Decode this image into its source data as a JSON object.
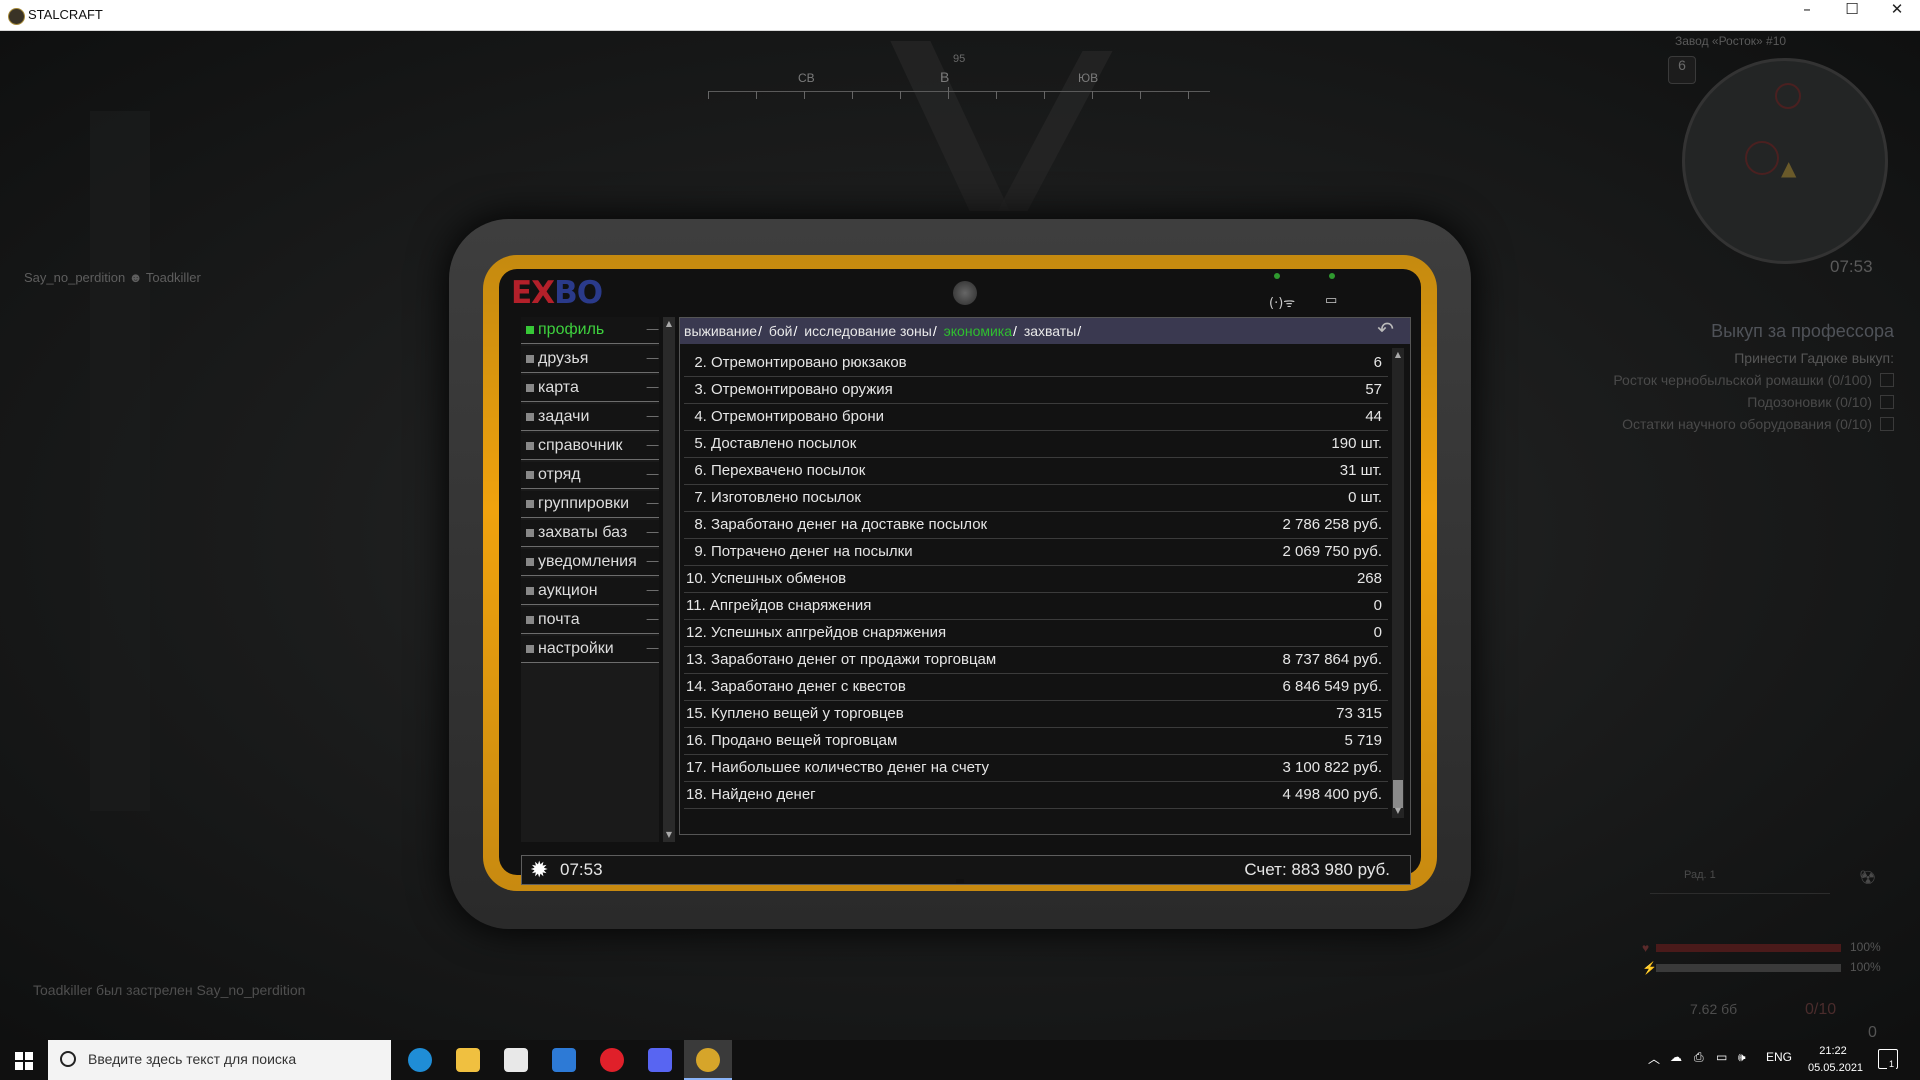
{
  "window": {
    "title": "STALCRAFT",
    "minimize": "–",
    "maximize": "☐",
    "close": "✕"
  },
  "hud": {
    "compass": {
      "heading": "95",
      "labels": [
        "СВ",
        "В",
        "ЮВ"
      ]
    },
    "killer_tag": "Say_no_perdition ☻ Toadkiller",
    "killfeed": "Toadkiller был застрелен Say_no_perdition",
    "minimap": {
      "zone": "Завод «Росток» #10",
      "level": "6",
      "time": "07:53"
    },
    "quest": {
      "title": "Выкуп за профессора",
      "subtitle": "Принести Гадюке выкуп:",
      "items": [
        "Росток чернобыльской ромашки (0/100)",
        "Подозоновик (0/10)",
        "Остатки научного оборудования (0/10)"
      ]
    },
    "status": {
      "rad_label": "Рад. 1",
      "rad_value": "0",
      "health": "100%",
      "stamina": "100%",
      "health_fill": 1.0,
      "stamina_fill": 1.0,
      "ammo_type": "7.62 бб",
      "magazine": "0/10",
      "ammo_count": "0",
      "grenade_count": "0"
    }
  },
  "pda": {
    "logo": {
      "left": "EX",
      "right": "BO"
    },
    "icons": {
      "signal": "(·)ᯤ",
      "battery": "▭"
    },
    "nav": [
      "профиль",
      "друзья",
      "карта",
      "задачи",
      "справочник",
      "отряд",
      "группировки",
      "захваты баз",
      "уведомления",
      "аукцион",
      "почта",
      "настройки"
    ],
    "active_nav": "профиль",
    "breadcrumbs": [
      "выживание",
      "бой",
      "исследование зоны",
      "экономика",
      "захваты"
    ],
    "active_crumb": "экономика",
    "back_icon": "↶",
    "stats": [
      {
        "label": "  2. Отремонтировано рюкзаков",
        "value": "6"
      },
      {
        "label": "  3. Отремонтировано оружия",
        "value": "57"
      },
      {
        "label": "  4. Отремонтировано брони",
        "value": "44"
      },
      {
        "label": "  5. Доставлено посылок",
        "value": "190 шт."
      },
      {
        "label": "  6. Перехвачено посылок",
        "value": "31 шт."
      },
      {
        "label": "  7. Изготовлено посылок",
        "value": "0 шт."
      },
      {
        "label": "  8. Заработано денег на доставке посылок",
        "value": "2 786 258 руб."
      },
      {
        "label": "  9. Потрачено денег на посылки",
        "value": "2 069 750 руб."
      },
      {
        "label": "10. Успешных обменов",
        "value": "268"
      },
      {
        "label": "11. Апгрейдов снаряжения",
        "value": "0"
      },
      {
        "label": "12. Успешных апгрейдов снаряжения",
        "value": "0"
      },
      {
        "label": "13. Заработано денег от продажи торговцам",
        "value": "8 737 864 руб."
      },
      {
        "label": "14. Заработано денег с квестов",
        "value": "6 846 549 руб."
      },
      {
        "label": "15. Куплено вещей у торговцев",
        "value": "73 315"
      },
      {
        "label": "16. Продано вещей торговцам",
        "value": "5 719"
      },
      {
        "label": "17. Наибольшее количество денег на счету",
        "value": "3 100 822 руб."
      },
      {
        "label": "18. Найдено денег",
        "value": "4 498 400 руб."
      }
    ],
    "footer": {
      "time": "07:53",
      "score": "Счет: 883 980 руб."
    }
  },
  "taskbar": {
    "search_placeholder": "Введите здесь текст для поиска",
    "apps": [
      "edge-icon",
      "file-explorer-icon",
      "store-icon",
      "mail-icon",
      "opera-icon",
      "discord-icon",
      "stalcraft-icon"
    ],
    "language": "ENG",
    "time": "21:22",
    "date": "05.05.2021",
    "notifications": "1"
  }
}
